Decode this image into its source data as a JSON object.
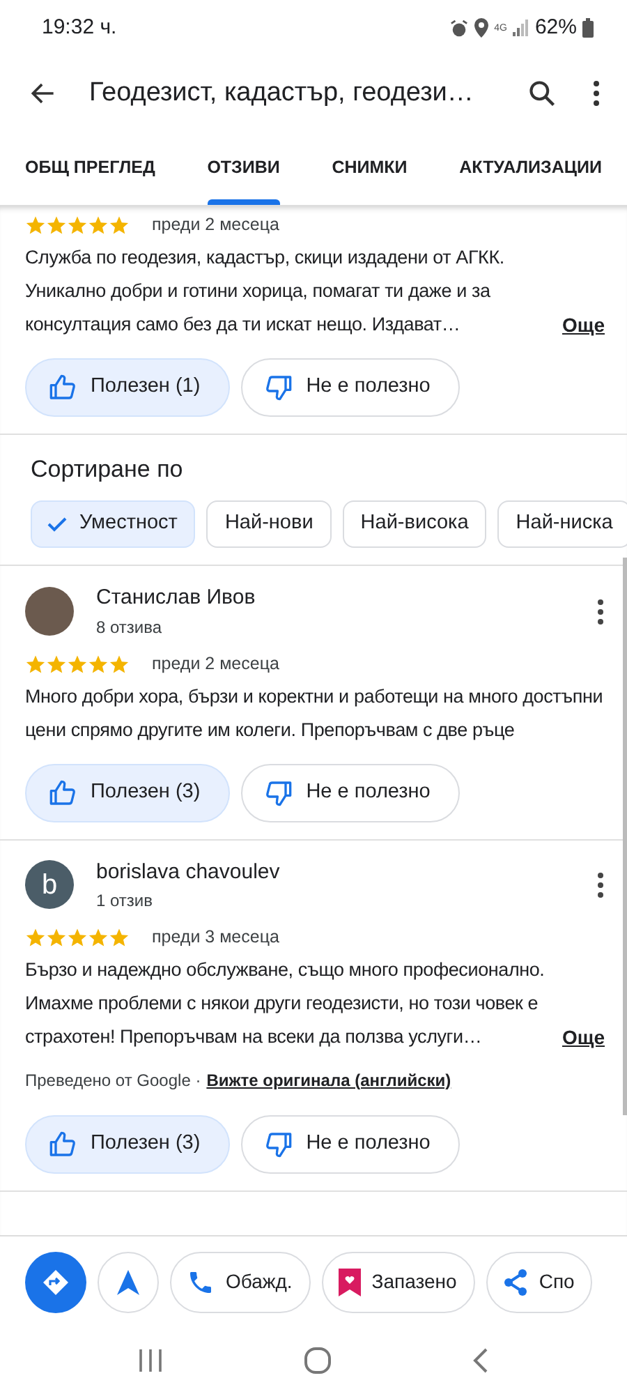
{
  "status_bar": {
    "time": "19:32 ч.",
    "network": "4G",
    "battery": "62%"
  },
  "app_bar": {
    "title": "Геодезист, кадастър, геодези…"
  },
  "tabs": [
    {
      "label": "ОБЩ ПРЕГЛЕД",
      "selected": false
    },
    {
      "label": "ОТЗИВИ",
      "selected": true
    },
    {
      "label": "СНИМКИ",
      "selected": false
    },
    {
      "label": "АКТУАЛИЗАЦИИ",
      "selected": false
    }
  ],
  "feed": [
    {
      "kind": "review",
      "stars": 5,
      "date": "преди 2 месеца",
      "text": "Служба по геодезия, кадастър, скици издадени от АГКК. Уникално добри и готини хорица, помагат ти даже и за консултация само без да ти искат нещо. Издават…",
      "more": "Още",
      "helpful": "Полезен (1)",
      "not_helpful": "Не е полезно"
    },
    {
      "kind": "sort",
      "title": "Сортиране по",
      "chips": [
        {
          "label": "Уместност",
          "selected": true
        },
        {
          "label": "Най-нови",
          "selected": false
        },
        {
          "label": "Най-висока",
          "selected": false
        },
        {
          "label": "Най-ниска",
          "selected": false
        }
      ]
    },
    {
      "kind": "review",
      "author": {
        "name": "Станислав Ивов",
        "count": "8 отзива",
        "avatar": {
          "kind": "photo"
        }
      },
      "stars": 5,
      "date": "преди 2 месеца",
      "text": "Много добри хора, бързи и коректни и работещи на много достъпни цени спрямо другите им колеги. Препоръчвам с две ръце",
      "helpful": "Полезен (3)",
      "not_helpful": "Не е полезно"
    },
    {
      "kind": "review",
      "author": {
        "name": "borislava chavoulev",
        "count": "1 отзив",
        "avatar": {
          "kind": "letter",
          "letter": "b"
        }
      },
      "stars": 5,
      "date": "преди 3 месеца",
      "text": "Бързо и надеждно обслужване, също много професионално. Имахме проблеми с някои други геодезисти, но този човек е страхотен! Препоръчвам на всеки да ползва услуги…",
      "more": "Още",
      "translation": {
        "note": "Преведено от Google ·",
        "link": "Вижте оригинала (английски)"
      },
      "helpful": "Полезен (3)",
      "not_helpful": "Не е полезно"
    }
  ],
  "actions": [
    {
      "kind": "directions"
    },
    {
      "kind": "start"
    },
    {
      "kind": "call",
      "label": "Обажд."
    },
    {
      "kind": "save",
      "label": "Запазено"
    },
    {
      "kind": "share",
      "label": "Спо"
    }
  ]
}
